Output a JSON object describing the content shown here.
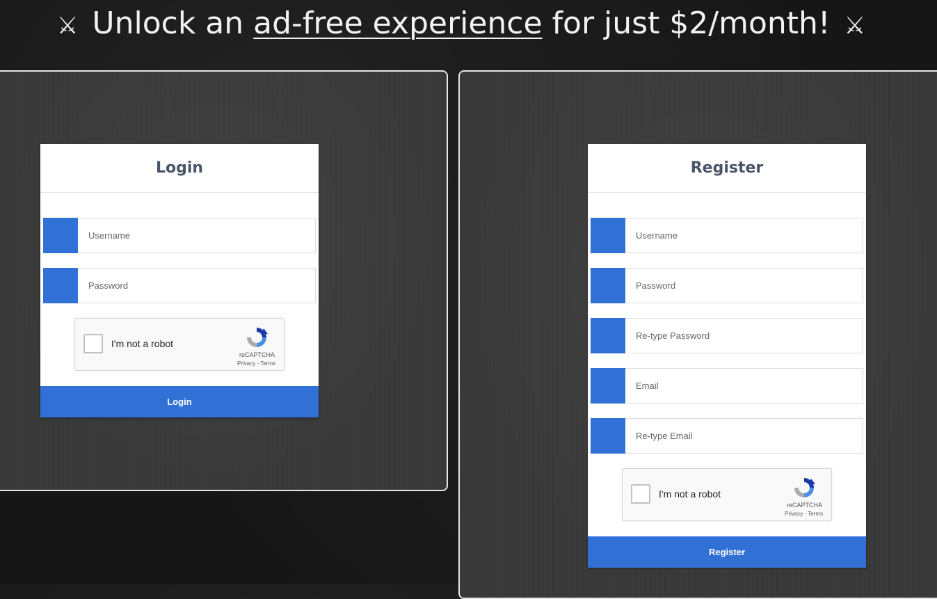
{
  "banner": {
    "prefix": "Unlock an",
    "link": "ad-free experience",
    "suffix": "for just $2/month!",
    "icon": "crossed-swords-icon"
  },
  "login": {
    "title": "Login",
    "fields": [
      {
        "placeholder": "Username",
        "value": ""
      },
      {
        "placeholder": "Password",
        "value": ""
      }
    ],
    "captcha": {
      "label": "I'm not a robot",
      "brand": "reCAPTCHA",
      "privacy": "Privacy",
      "separator": "-",
      "terms": "Terms"
    },
    "button": "Login"
  },
  "register": {
    "title": "Register",
    "fields": [
      {
        "placeholder": "Username",
        "value": ""
      },
      {
        "placeholder": "Password",
        "value": ""
      },
      {
        "placeholder": "Re-type Password",
        "value": ""
      },
      {
        "placeholder": "Email",
        "value": ""
      },
      {
        "placeholder": "Re-type Email",
        "value": ""
      }
    ],
    "captcha": {
      "label": "I'm not a robot",
      "brand": "reCAPTCHA",
      "privacy": "Privacy",
      "separator": "-",
      "terms": "Terms"
    },
    "button": "Register"
  },
  "colors": {
    "accent": "#3170d4",
    "title": "#4a5468",
    "panel": "#3a3a3a",
    "background": "#161616"
  }
}
